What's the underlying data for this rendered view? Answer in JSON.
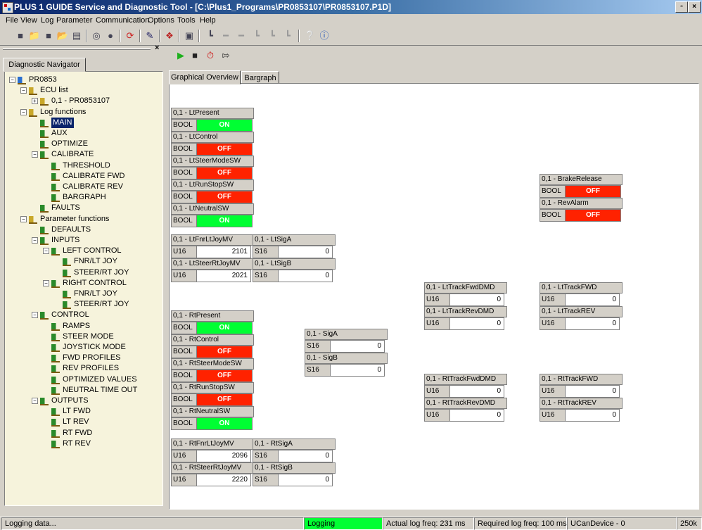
{
  "window": {
    "title": "PLUS 1 GUIDE Service and Diagnostic Tool - [C:\\Plus1_Programs\\PR0853107\\PR0853107.P1D]"
  },
  "menu": [
    "File",
    "View",
    "Log",
    "Parameter",
    "Communication",
    "Options",
    "Tools",
    "Help"
  ],
  "toolbar_icons": [
    "new-icon",
    "open-icon",
    "save-icon",
    "open-folder-icon",
    "disk-icon",
    "binoculars-icon",
    "find-icon",
    "refresh-icon",
    "edit-icon",
    "download-icon",
    "layout-icon",
    "flag-1-icon",
    "flag-2-icon",
    "flag-3-icon",
    "flag-4-icon",
    "flag-5-icon",
    "flag-6-icon",
    "help-icon",
    "info-icon"
  ],
  "navigator": {
    "tab_label": "Diagnostic Navigator",
    "nodes": [
      {
        "label": "PR0853",
        "level": 0,
        "expander": "−",
        "icon": "gear-icon",
        "color": "#2a6fd0"
      },
      {
        "label": "ECU list",
        "level": 1,
        "expander": "−",
        "icon": "folder-icon",
        "color": "#c9a82a"
      },
      {
        "label": "0,1 - PR0853107",
        "level": 2,
        "expander": "+",
        "icon": "ecu-icon",
        "color": "#c9a82a"
      },
      {
        "label": "Log functions",
        "level": 1,
        "expander": "−",
        "icon": "log-folder-icon",
        "color": "#c9a82a"
      },
      {
        "label": "MAIN",
        "level": 2,
        "expander": "",
        "icon": "log-icon",
        "color": "#2a8a2a",
        "selected": true
      },
      {
        "label": "AUX",
        "level": 2,
        "expander": "",
        "icon": "log-icon",
        "color": "#2a8a2a"
      },
      {
        "label": "OPTIMIZE",
        "level": 2,
        "expander": "",
        "icon": "log-icon",
        "color": "#2a8a2a"
      },
      {
        "label": "CALIBRATE",
        "level": 2,
        "expander": "−",
        "icon": "log-icon",
        "color": "#2a8a2a"
      },
      {
        "label": "THRESHOLD",
        "level": 3,
        "expander": "",
        "icon": "log-icon",
        "color": "#2a8a2a"
      },
      {
        "label": "CALIBRATE FWD",
        "level": 3,
        "expander": "",
        "icon": "log-icon",
        "color": "#2a8a2a"
      },
      {
        "label": "CALIBRATE REV",
        "level": 3,
        "expander": "",
        "icon": "log-icon",
        "color": "#2a8a2a"
      },
      {
        "label": "BARGRAPH",
        "level": 3,
        "expander": "",
        "icon": "log-icon",
        "color": "#2a8a2a"
      },
      {
        "label": "FAULTS",
        "level": 2,
        "expander": "",
        "icon": "log-icon",
        "color": "#2a8a2a"
      },
      {
        "label": "Parameter functions",
        "level": 1,
        "expander": "−",
        "icon": "param-folder-icon",
        "color": "#c9a82a"
      },
      {
        "label": "DEFAULTS",
        "level": 2,
        "expander": "",
        "icon": "param-icon",
        "color": "#2a8a2a"
      },
      {
        "label": "INPUTS",
        "level": 2,
        "expander": "−",
        "icon": "param-icon",
        "color": "#2a8a2a"
      },
      {
        "label": "LEFT CONTROL",
        "level": 3,
        "expander": "−",
        "icon": "param-icon",
        "color": "#2a8a2a"
      },
      {
        "label": "FNR/LT JOY",
        "level": 4,
        "expander": "",
        "icon": "param-icon",
        "color": "#2a8a2a"
      },
      {
        "label": "STEER/RT JOY",
        "level": 4,
        "expander": "",
        "icon": "param-icon",
        "color": "#2a8a2a"
      },
      {
        "label": "RIGHT CONTROL",
        "level": 3,
        "expander": "−",
        "icon": "param-icon",
        "color": "#2a8a2a"
      },
      {
        "label": "FNR/LT JOY",
        "level": 4,
        "expander": "",
        "icon": "param-icon",
        "color": "#2a8a2a"
      },
      {
        "label": "STEER/RT JOY",
        "level": 4,
        "expander": "",
        "icon": "param-icon",
        "color": "#2a8a2a"
      },
      {
        "label": "CONTROL",
        "level": 2,
        "expander": "−",
        "icon": "param-icon",
        "color": "#2a8a2a"
      },
      {
        "label": "RAMPS",
        "level": 3,
        "expander": "",
        "icon": "param-icon",
        "color": "#2a8a2a"
      },
      {
        "label": "STEER MODE",
        "level": 3,
        "expander": "",
        "icon": "param-icon",
        "color": "#2a8a2a"
      },
      {
        "label": "JOYSTICK MODE",
        "level": 3,
        "expander": "",
        "icon": "param-icon",
        "color": "#2a8a2a"
      },
      {
        "label": "FWD PROFILES",
        "level": 3,
        "expander": "",
        "icon": "param-icon",
        "color": "#2a8a2a"
      },
      {
        "label": "REV PROFILES",
        "level": 3,
        "expander": "",
        "icon": "param-icon",
        "color": "#2a8a2a"
      },
      {
        "label": "OPTIMIZED VALUES",
        "level": 3,
        "expander": "",
        "icon": "param-icon",
        "color": "#2a8a2a"
      },
      {
        "label": "NEUTRAL TIME OUT",
        "level": 3,
        "expander": "",
        "icon": "param-icon",
        "color": "#2a8a2a"
      },
      {
        "label": "OUTPUTS",
        "level": 2,
        "expander": "−",
        "icon": "param-icon",
        "color": "#2a8a2a"
      },
      {
        "label": "LT FWD",
        "level": 3,
        "expander": "",
        "icon": "param-icon",
        "color": "#2a8a2a"
      },
      {
        "label": "LT REV",
        "level": 3,
        "expander": "",
        "icon": "param-icon",
        "color": "#2a8a2a"
      },
      {
        "label": "RT FWD",
        "level": 3,
        "expander": "",
        "icon": "param-icon",
        "color": "#2a8a2a"
      },
      {
        "label": "RT REV",
        "level": 3,
        "expander": "",
        "icon": "param-icon",
        "color": "#2a8a2a"
      }
    ]
  },
  "log_controls": [
    "play-icon",
    "stop-icon",
    "timer-icon",
    "export-icon"
  ],
  "tabs": [
    {
      "label": "Graphical Overview",
      "active": true
    },
    {
      "label": "Bargraph",
      "active": false
    }
  ],
  "variables": [
    {
      "name": "0,1 - LtPresent",
      "type": "BOOL",
      "value": "ON",
      "kind": "on"
    },
    {
      "name": "0,1 - LtControl",
      "type": "BOOL",
      "value": "OFF",
      "kind": "off"
    },
    {
      "name": "0,1 - LtSteerModeSW",
      "type": "BOOL",
      "value": "OFF",
      "kind": "off"
    },
    {
      "name": "0,1 - LtRunStopSW",
      "type": "BOOL",
      "value": "OFF",
      "kind": "off"
    },
    {
      "name": "0,1 - LtNeutralSW",
      "type": "BOOL",
      "value": "ON",
      "kind": "on"
    },
    {
      "name": "0,1 - LtFnrLtJoyMV",
      "type": "U16",
      "value": "2101",
      "kind": "num"
    },
    {
      "name": "0,1 - LtSigA",
      "type": "S16",
      "value": "0",
      "kind": "num"
    },
    {
      "name": "0,1 - LtSteerRtJoyMV",
      "type": "U16",
      "value": "2021",
      "kind": "num"
    },
    {
      "name": "0,1 - LtSigB",
      "type": "S16",
      "value": "0",
      "kind": "num"
    },
    {
      "name": "0,1 - RtPresent",
      "type": "BOOL",
      "value": "ON",
      "kind": "on"
    },
    {
      "name": "0,1 - RtControl",
      "type": "BOOL",
      "value": "OFF",
      "kind": "off"
    },
    {
      "name": "0,1 - RtSteerModeSW",
      "type": "BOOL",
      "value": "OFF",
      "kind": "off"
    },
    {
      "name": "0,1 - RtRunStopSW",
      "type": "BOOL",
      "value": "OFF",
      "kind": "off"
    },
    {
      "name": "0,1 - RtNeutralSW",
      "type": "BOOL",
      "value": "ON",
      "kind": "on"
    },
    {
      "name": "0,1 - RtFnrLtJoyMV",
      "type": "U16",
      "value": "2096",
      "kind": "num"
    },
    {
      "name": "0,1 - RtSigA",
      "type": "S16",
      "value": "0",
      "kind": "num"
    },
    {
      "name": "0,1 - RtSteerRtJoyMV",
      "type": "U16",
      "value": "2220",
      "kind": "num"
    },
    {
      "name": "0,1 - RtSigB",
      "type": "S16",
      "value": "0",
      "kind": "num"
    },
    {
      "name": "0,1 - SigA",
      "type": "S16",
      "value": "0",
      "kind": "num"
    },
    {
      "name": "0,1 - SigB",
      "type": "S16",
      "value": "0",
      "kind": "num"
    },
    {
      "name": "0,1 - LtTrackFwdDMD",
      "type": "U16",
      "value": "0",
      "kind": "num"
    },
    {
      "name": "0,1 - LtTrackRevDMD",
      "type": "U16",
      "value": "0",
      "kind": "num"
    },
    {
      "name": "0,1 - RtTrackFwdDMD",
      "type": "U16",
      "value": "0",
      "kind": "num"
    },
    {
      "name": "0,1 - RtTrackRevDMD",
      "type": "U16",
      "value": "0",
      "kind": "num"
    },
    {
      "name": "0,1 - LtTrackFWD",
      "type": "U16",
      "value": "0",
      "kind": "num"
    },
    {
      "name": "0,1 - LtTrackREV",
      "type": "U16",
      "value": "0",
      "kind": "num"
    },
    {
      "name": "0,1 - RtTrackFWD",
      "type": "U16",
      "value": "0",
      "kind": "num"
    },
    {
      "name": "0,1 - RtTrackREV",
      "type": "U16",
      "value": "0",
      "kind": "num"
    },
    {
      "name": "0,1 - BrakeRelease",
      "type": "BOOL",
      "value": "OFF",
      "kind": "off"
    },
    {
      "name": "0,1 - RevAlarm",
      "type": "BOOL",
      "value": "OFF",
      "kind": "off"
    }
  ],
  "status": {
    "message": "Logging data...",
    "logging": "Logging",
    "logging_color": "#00ff33",
    "actual_freq": "Actual log freq: 231 ms",
    "required_freq": "Required log freq: 100 ms",
    "device": "UCanDevice  - 0",
    "baud": "250k"
  },
  "colors": {
    "on": "#00ff33",
    "off": "#ff2200",
    "nav_bg": "#f6f3dc",
    "selection": "#0a246a"
  }
}
